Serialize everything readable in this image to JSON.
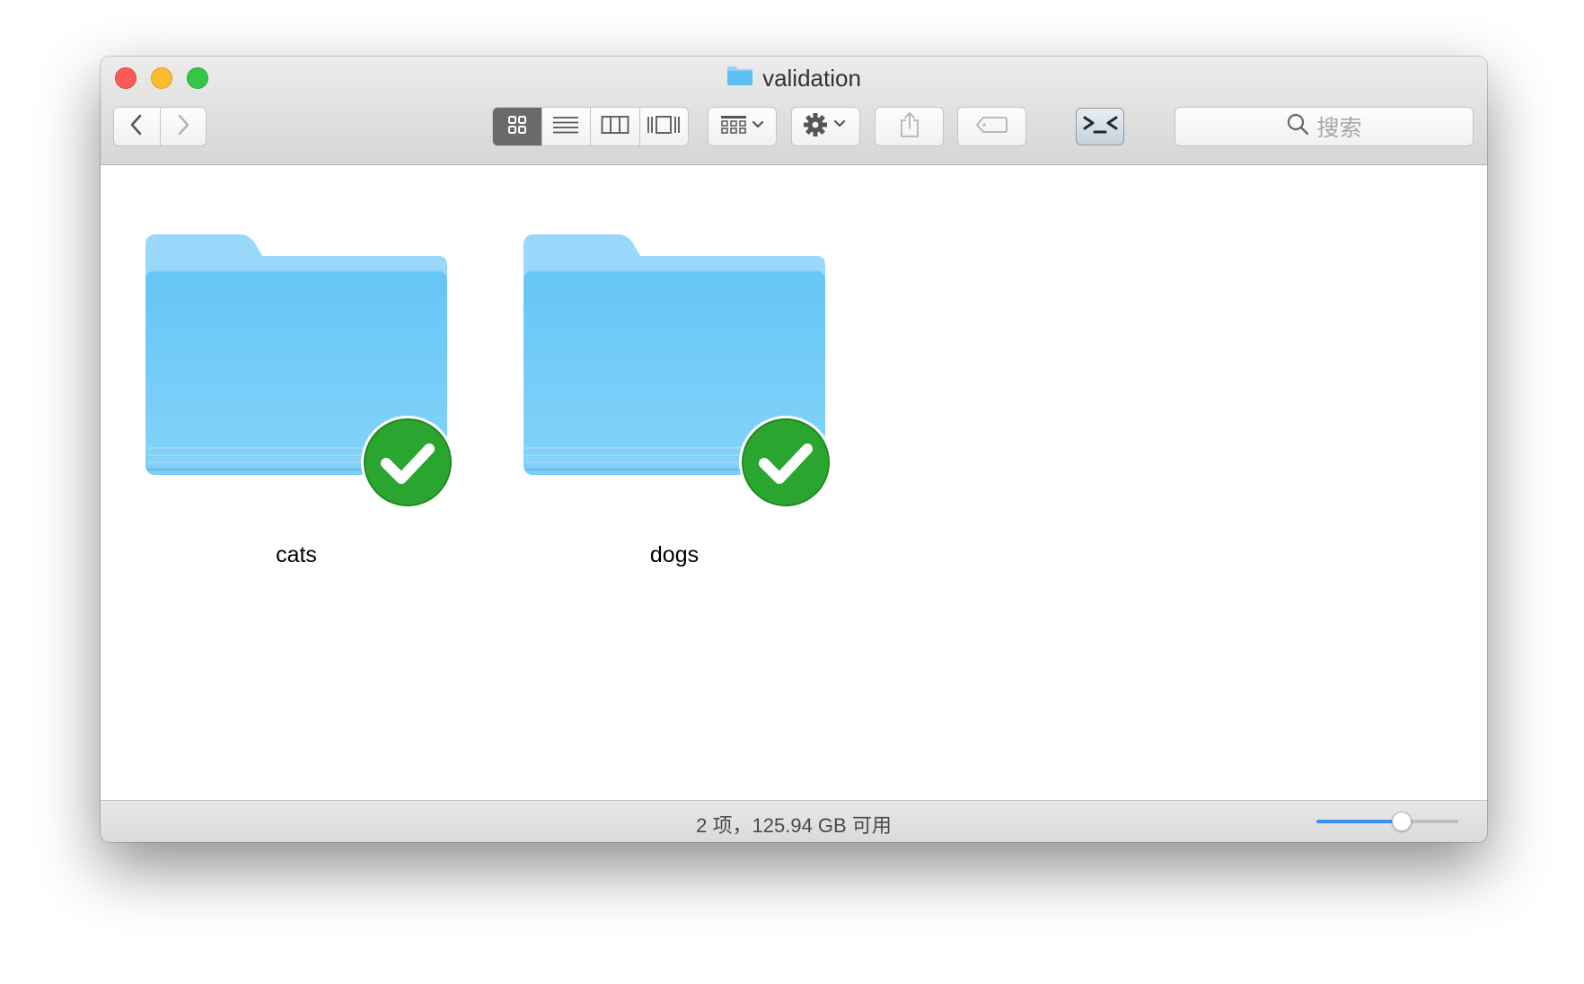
{
  "window": {
    "title": "validation"
  },
  "toolbar": {
    "search_placeholder": "搜索"
  },
  "items": [
    {
      "name": "cats",
      "status": "synced"
    },
    {
      "name": "dogs",
      "status": "synced"
    }
  ],
  "statusbar": {
    "text": "2 项，125.94 GB 可用",
    "icon_size_level": 0.6
  },
  "colors": {
    "folder_light": "#9ad8fb",
    "folder_main": "#6cc8f6",
    "check_green": "#2aa52f",
    "slider_fill": "#3a8ff3"
  }
}
